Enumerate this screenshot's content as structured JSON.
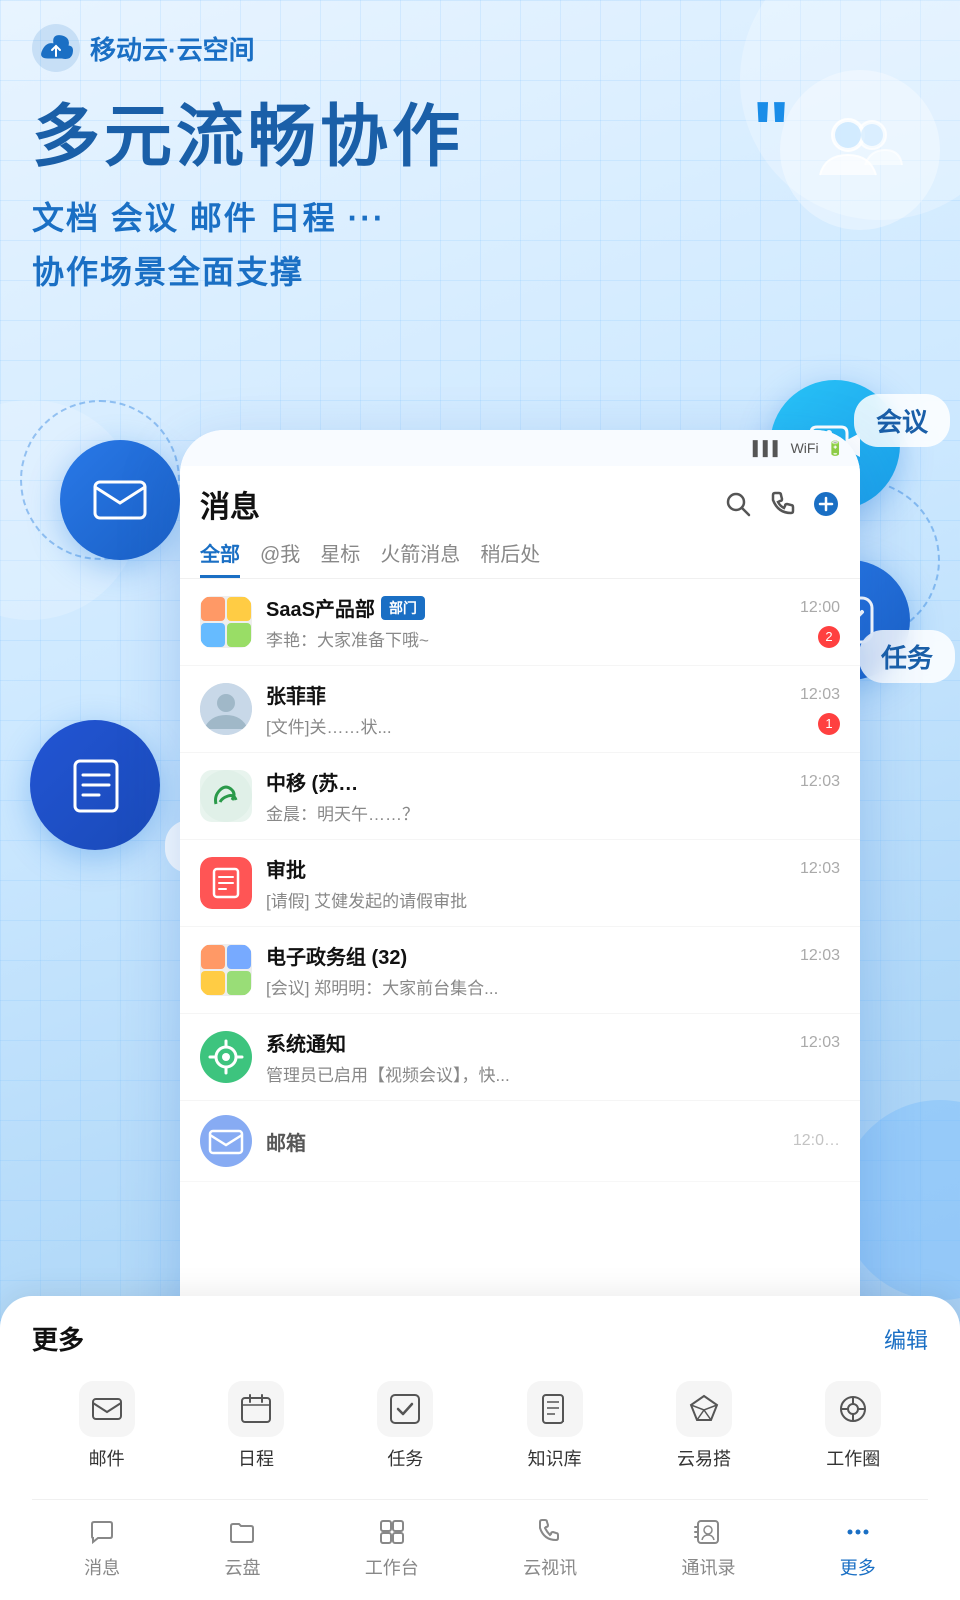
{
  "brand": {
    "name": "移动云·云空间",
    "logo_alt": "移动云 logo"
  },
  "hero": {
    "title": "多元流畅协作",
    "subtitle1": "文档  会议  邮件  日程  ···",
    "subtitle2": "协作场景全面支撑"
  },
  "features": {
    "mail_label": "邮件",
    "meeting_label": "会议",
    "doc_label": "文档",
    "schedule_label": "日程",
    "task_label": "任务"
  },
  "message_app": {
    "title": "消息",
    "tabs": [
      "全部",
      "@我",
      "星标",
      "火箭消息",
      "稍后处"
    ],
    "active_tab": 0,
    "items": [
      {
        "name": "SaaS产品部",
        "badge": "部门",
        "preview": "李艳：大家准备下哦~",
        "time": "12:00",
        "unread": 2,
        "avatar_type": "group"
      },
      {
        "name": "张菲菲",
        "badge": "",
        "preview": "[文件]关……状...",
        "time": "12:03",
        "unread": 1,
        "avatar_type": "person"
      },
      {
        "name": "中移 (苏…",
        "badge": "",
        "preview": "金晨：明天午……？",
        "time": "12:03",
        "unread": 0,
        "avatar_type": "logo"
      },
      {
        "name": "审批",
        "badge": "",
        "preview": "[请假] 艾健发起的请假审批",
        "time": "12:03",
        "unread": 0,
        "avatar_type": "approval"
      },
      {
        "name": "电子政务组 (32)",
        "badge": "",
        "preview": "[会议] 郑明明：大家前台集合...",
        "time": "12:03",
        "unread": 0,
        "avatar_type": "group2"
      },
      {
        "name": "系统通知",
        "badge": "",
        "preview": "管理员已启用【视频会议】，快...",
        "time": "12:03",
        "unread": 0,
        "avatar_type": "system"
      },
      {
        "name": "邮箱",
        "badge": "",
        "preview": "",
        "time": "12:0…",
        "unread": 0,
        "avatar_type": "mail"
      }
    ]
  },
  "bottom_panel": {
    "title": "更多",
    "edit_label": "编辑",
    "icons_row1": [
      {
        "icon": "mail",
        "label": "邮件"
      },
      {
        "icon": "calendar",
        "label": "日程"
      },
      {
        "icon": "task",
        "label": "任务"
      },
      {
        "icon": "knowledge",
        "label": "知识库"
      },
      {
        "icon": "cloud-easy",
        "label": "云易搭"
      },
      {
        "icon": "work-circle",
        "label": "工作圈"
      }
    ],
    "nav_items": [
      {
        "icon": "message",
        "label": "消息",
        "active": false
      },
      {
        "icon": "cloud-disk",
        "label": "云盘",
        "active": false
      },
      {
        "icon": "workspace",
        "label": "工作台",
        "active": false
      },
      {
        "icon": "video-call",
        "label": "云视讯",
        "active": false
      },
      {
        "icon": "contacts",
        "label": "通讯录",
        "active": false
      },
      {
        "icon": "more",
        "label": "更多",
        "active": true
      }
    ]
  },
  "colors": {
    "primary": "#1a6fc4",
    "primary_dark": "#1a5fa8",
    "accent_cyan": "#29c4f8",
    "bg_light": "#e8f4ff",
    "white": "#ffffff",
    "red": "#ff4040"
  }
}
